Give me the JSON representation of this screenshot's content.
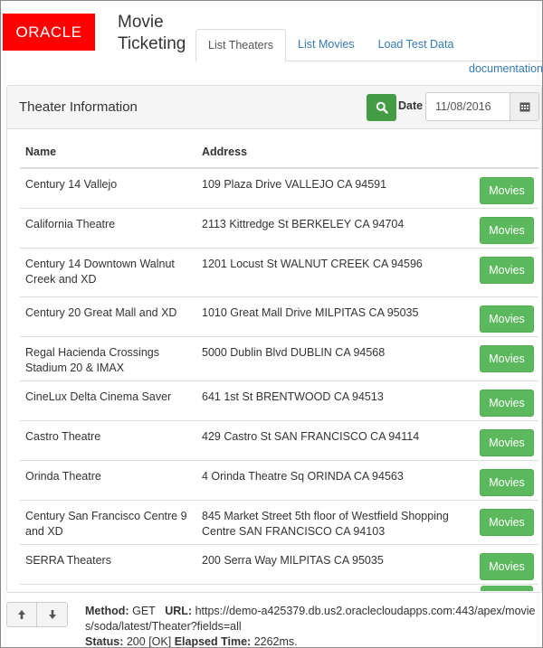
{
  "brand": {
    "logo_text": "ORACLE",
    "logo_color": "#ff0000"
  },
  "app": {
    "title": "Movie Ticketing"
  },
  "tabs": [
    {
      "label": "List Theaters",
      "active": true
    },
    {
      "label": "List Movies",
      "active": false
    },
    {
      "label": "Load Test Data",
      "active": false
    }
  ],
  "documentation_link": "documentation",
  "panel": {
    "title": "Theater Information",
    "date_label": "Date",
    "date_value": "11/08/2016"
  },
  "table": {
    "columns": [
      "Name",
      "Address"
    ],
    "button_label": "Movies",
    "rows": [
      {
        "name": "Century 14 Vallejo",
        "address": "109 Plaza Drive VALLEJO CA 94591"
      },
      {
        "name": "California Theatre",
        "address": "2113 Kittredge St BERKELEY CA 94704"
      },
      {
        "name": "Century 14 Downtown Walnut Creek and XD",
        "address": "1201 Locust St WALNUT CREEK CA 94596"
      },
      {
        "name": "Century 20 Great Mall and XD",
        "address": "1010 Great Mall Drive MILPITAS CA 95035"
      },
      {
        "name": "Regal Hacienda Crossings Stadium 20 & IMAX",
        "address": "5000 Dublin Blvd DUBLIN CA 94568"
      },
      {
        "name": "CineLux Delta Cinema Saver",
        "address": "641 1st St BRENTWOOD CA 94513"
      },
      {
        "name": "Castro Theatre",
        "address": "429 Castro St SAN FRANCISCO CA 94114"
      },
      {
        "name": "Orinda Theatre",
        "address": "4 Orinda Theatre Sq ORINDA CA 94563"
      },
      {
        "name": "Century San Francisco Centre 9 and XD",
        "address": "845 Market Street 5th floor of Westfield Shopping Centre SAN FRANCISCO CA 94103"
      },
      {
        "name": "SERRA Theaters",
        "address": "200 Serra Way MILPITAS CA 95035"
      }
    ]
  },
  "request": {
    "method_label": "Method:",
    "method": "GET",
    "url_label": "URL:",
    "url": "https://demo-a425379.db.us2.oraclecloudapps.com:443/apex/movies/soda/latest/Theater?fields=all",
    "status_label": "Status:",
    "status": "200 [OK]",
    "elapsed_label": "Elapsed Time:",
    "elapsed": "2262ms."
  }
}
